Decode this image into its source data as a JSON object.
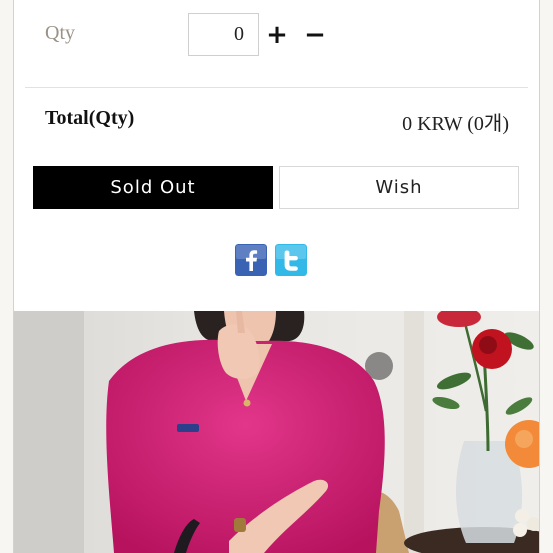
{
  "qty": {
    "label": "Qty",
    "value": "0",
    "plus": "+",
    "minus": "−"
  },
  "total": {
    "label": "Total(Qty)",
    "value": "0 KRW (0개)"
  },
  "buttons": {
    "sold_out": "Sold Out",
    "wish": "Wish"
  },
  "social": [
    {
      "name": "facebook-icon",
      "glyph": "f",
      "color": "#3b63b4"
    },
    {
      "name": "twitter-icon",
      "glyph": "t",
      "color": "#33b9e8"
    }
  ],
  "photo": {
    "subject": "pink-fluffy-sweater-model"
  },
  "colors": {
    "sold_out_bg": "#000000",
    "sweater": "#d61f7a",
    "rose": "#c0121f"
  }
}
